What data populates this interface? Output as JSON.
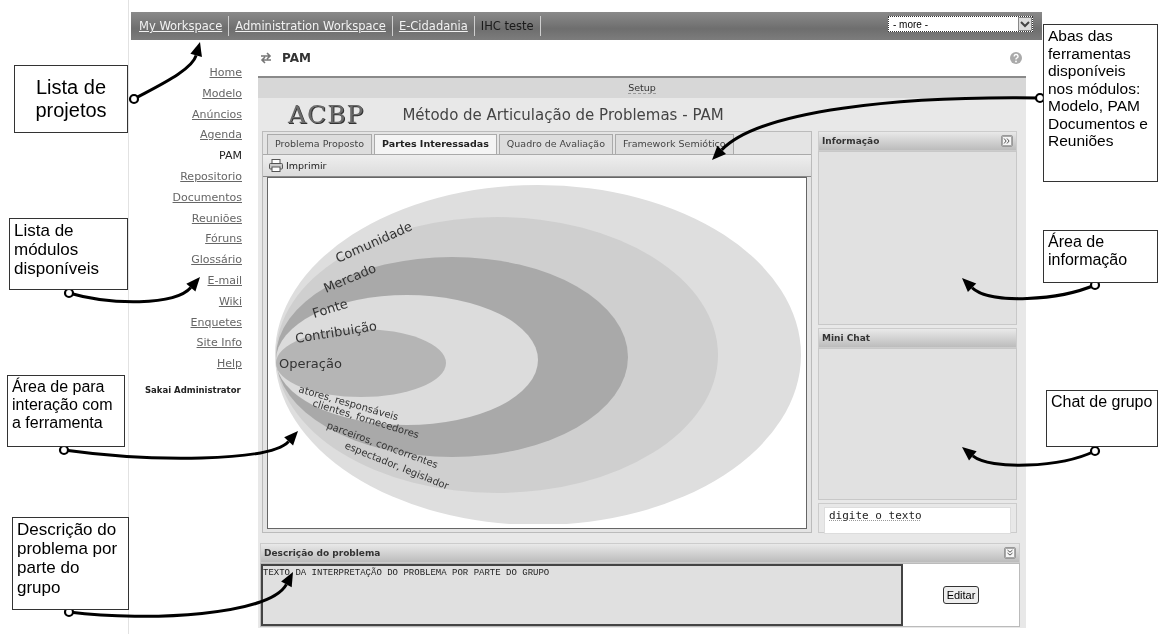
{
  "top_bar": {
    "sites": [
      {
        "label": "My Workspace",
        "selected": false
      },
      {
        "label": "Administration Workspace",
        "selected": false
      },
      {
        "label": "E-Cidadania",
        "selected": false
      },
      {
        "label": "IHC teste",
        "selected": true
      }
    ],
    "more_dropdown": "- more -"
  },
  "sidebar": {
    "items": [
      {
        "label": "Home",
        "selected": false
      },
      {
        "label": "Modelo",
        "selected": false
      },
      {
        "label": "Anúncios",
        "selected": false
      },
      {
        "label": "Agenda",
        "selected": false
      },
      {
        "label": "PAM",
        "selected": true
      },
      {
        "label": "Repositorio",
        "selected": false
      },
      {
        "label": "Documentos",
        "selected": false
      },
      {
        "label": "Reuniões",
        "selected": false
      },
      {
        "label": "Fóruns",
        "selected": false
      },
      {
        "label": "Glossário",
        "selected": false
      },
      {
        "label": "E-mail",
        "selected": false
      },
      {
        "label": "Wiki",
        "selected": false
      },
      {
        "label": "Enquetes",
        "selected": false
      },
      {
        "label": "Site Info",
        "selected": false
      },
      {
        "label": "Help",
        "selected": false
      }
    ],
    "user": "Sakai Administrator"
  },
  "tool": {
    "title": "PAM",
    "setup": "Setup",
    "logo": "ACBP",
    "heading": "Método de Articulação de Problemas - PAM",
    "tabs": [
      {
        "label": "Problema Proposto",
        "selected": false
      },
      {
        "label": "Partes Interessadas",
        "selected": true
      },
      {
        "label": "Quadro de Avaliação",
        "selected": false
      },
      {
        "label": "Framework Semiótico",
        "selected": false
      }
    ],
    "print_button": "Imprimir",
    "diagram": {
      "rings": [
        {
          "label": "Comunidade",
          "roles": "espectador, legislador"
        },
        {
          "label": "Mercado",
          "roles": "parceiros, concorrentes"
        },
        {
          "label": "Fonte",
          "roles": "clientes, fornecedores"
        },
        {
          "label": "Contribuição",
          "roles": "atores, responsáveis"
        },
        {
          "label": "Operação"
        }
      ]
    },
    "info_panel": {
      "title": "Informação"
    },
    "chat_panel": {
      "title": "Mini Chat",
      "input_value": "digite o texto"
    },
    "description": {
      "title": "Descrição do problema",
      "text": "TEXTO DA INTERPRETAÇÃO DO PROBLEMA POR PARTE DO GRUPO",
      "edit_button": "Editar"
    }
  },
  "annotations": [
    {
      "text": "Lista de projetos"
    },
    {
      "text": "Abas das ferramentas disponíveis nos módulos: Modelo, PAM Documentos e Reuniões"
    },
    {
      "text": "Lista de módulos disponíveis"
    },
    {
      "text": "Área de informação"
    },
    {
      "text": "Área de para interação com a ferramenta"
    },
    {
      "text": "Chat de grupo"
    },
    {
      "text": "Descrição do problema por parte do grupo"
    }
  ]
}
